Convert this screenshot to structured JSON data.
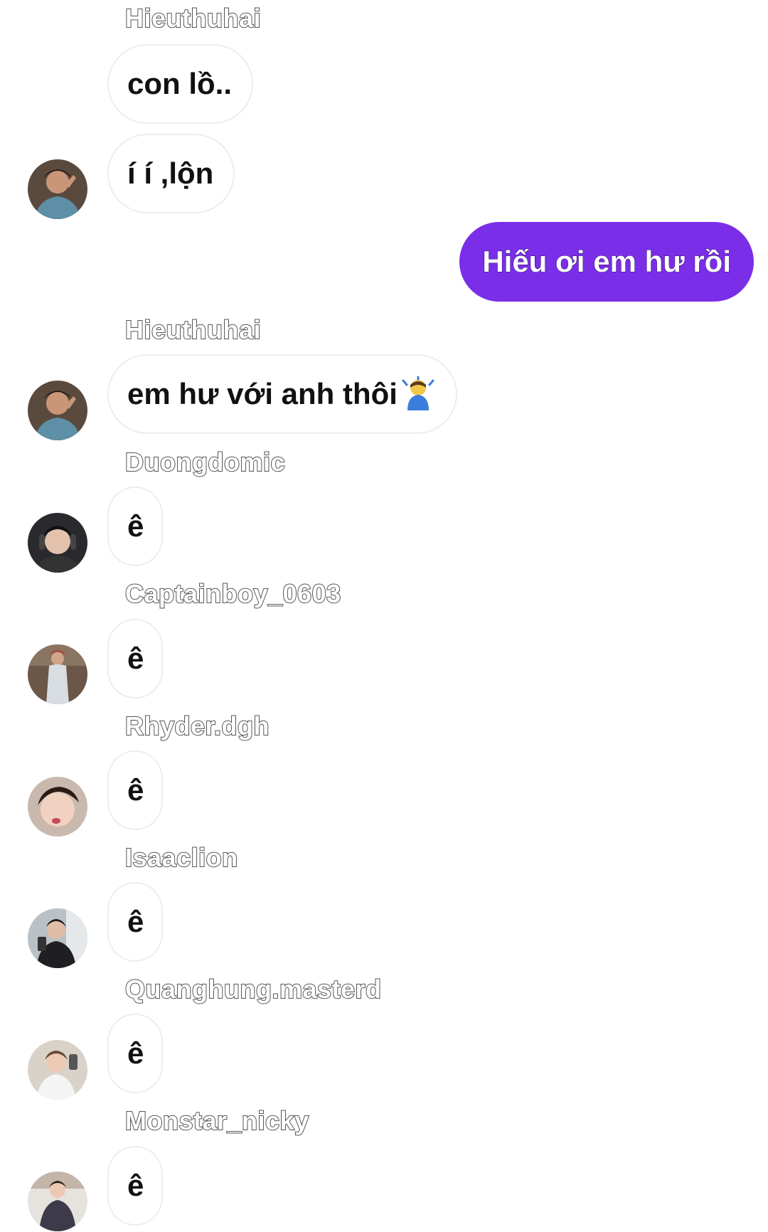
{
  "messages": [
    {
      "sender": "Hieuthuhai",
      "text": "con lồ.."
    },
    {
      "text": "í í ,lộn"
    },
    {
      "mine": true,
      "text": "Hiếu ơi em hư rồi"
    },
    {
      "sender": "Hieuthuhai",
      "text": "em hư với anh thôi",
      "emoji": "bowing-man-icon"
    },
    {
      "sender": "Duongdomic",
      "text": "ê"
    },
    {
      "sender": "Captainboy_0603",
      "text": "ê"
    },
    {
      "sender": "Rhyder.dgh",
      "text": "ê"
    },
    {
      "sender": "Isaaclion",
      "text": "ê"
    },
    {
      "sender": "Quanghung.masterd",
      "text": "ê"
    },
    {
      "sender": "Monstar_nicky",
      "text": "ê"
    }
  ],
  "colors": {
    "my_bubble": "#7a2ee8",
    "their_bubble_border": "#ededed",
    "background": "#ffffff"
  }
}
